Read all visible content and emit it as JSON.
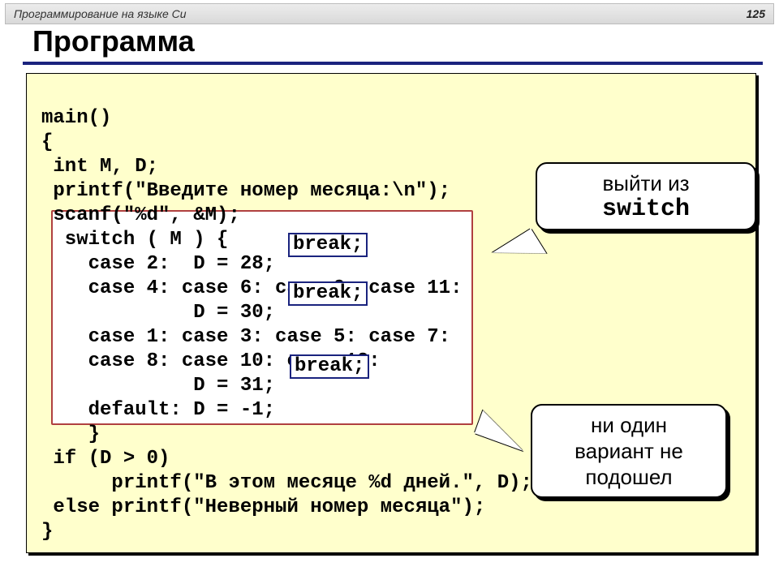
{
  "header": {
    "course": "Программирование на языке Си",
    "page_number": "125"
  },
  "title": "Программа",
  "code": {
    "l1": "main()",
    "l2": "{",
    "l3": " int M, D;",
    "l4": " printf(\"Введите номер месяца:\\n\");",
    "l5": " scanf(\"%d\", &M);",
    "l6": "  switch ( M ) {",
    "l7": "    case 2:  D = 28;",
    "l8": "    case 4: case 6: case 9: case 11:",
    "l9": "             D = 30;",
    "l10": "    case 1: case 3: case 5: case 7:",
    "l11": "    case 8: case 10: case 12:",
    "l12": "             D = 31;",
    "l13": "    default: D = -1;",
    "l14": "    }",
    "l15": " if (D > 0)",
    "l16": "      printf(\"В этом месяце %d дней.\", D);",
    "l17": " else printf(\"Неверный номер месяца\");",
    "l18": "}"
  },
  "break_label": "break;",
  "callouts": {
    "exit_switch_line1": "выйти из",
    "exit_switch_mono": "switch",
    "no_match_line1": "ни один",
    "no_match_line2": "вариант не",
    "no_match_line3": "подошел"
  }
}
